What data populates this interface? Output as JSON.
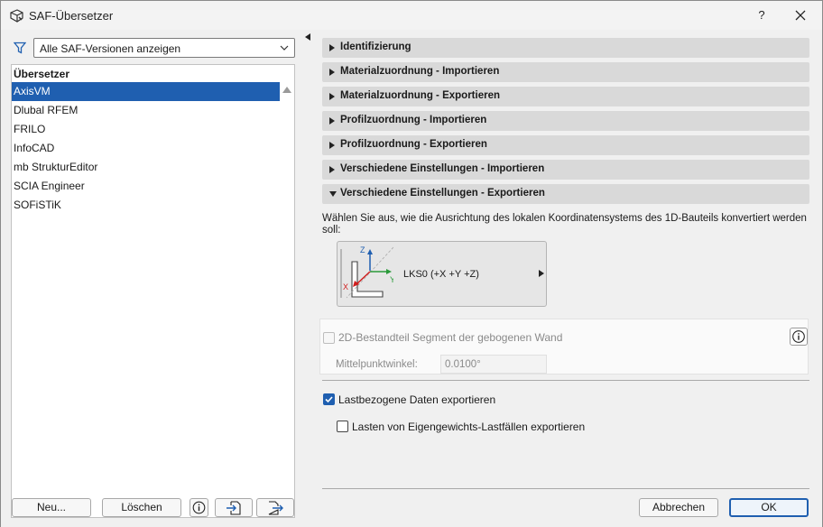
{
  "window": {
    "title": "SAF-Übersetzer",
    "help_label": "?"
  },
  "left": {
    "filter": {
      "icon": "filter-icon",
      "selected_value": "Alle SAF-Versionen anzeigen"
    },
    "list": {
      "header": "Übersetzer",
      "items": [
        {
          "label": "AxisVM",
          "selected": true
        },
        {
          "label": "Dlubal RFEM"
        },
        {
          "label": "FRILO"
        },
        {
          "label": "InfoCAD"
        },
        {
          "label": "mb StrukturEditor"
        },
        {
          "label": "SCIA Engineer"
        },
        {
          "label": "SOFiSTiK"
        }
      ]
    },
    "buttons": {
      "new_label": "Neu...",
      "delete_label": "Löschen"
    }
  },
  "right": {
    "sections": [
      {
        "label": "Identifizierung",
        "expanded": false
      },
      {
        "label": "Materialzuordnung - Importieren",
        "expanded": false
      },
      {
        "label": "Materialzuordnung - Exportieren",
        "expanded": false
      },
      {
        "label": "Profilzuordnung - Importieren",
        "expanded": false
      },
      {
        "label": "Profilzuordnung - Exportieren",
        "expanded": false
      },
      {
        "label": "Verschiedene Einstellungen - Importieren",
        "expanded": false
      },
      {
        "label": "Verschiedene Einstellungen - Exportieren",
        "expanded": true
      }
    ],
    "description": "Wählen Sie aus, wie die Ausrichtung des lokalen Koordinatensystems des 1D-Bauteils konvertiert werden soll:",
    "lks": {
      "label": "LKS0 (+X +Y +Z)",
      "axis_z": "Z",
      "axis_y": "Y",
      "axis_x": "X"
    },
    "segment": {
      "label": "2D-Bestandteil Segment der gebogenen Wand",
      "checked": false,
      "enabled": false
    },
    "angle": {
      "label": "Mittelpunktwinkel:",
      "value": "0.0100°"
    },
    "load_data": {
      "label": "Lastbezogene Daten exportieren",
      "checked": true
    },
    "self_weight": {
      "label": "Lasten von Eigengewichts-Lastfällen exportieren",
      "checked": false
    }
  },
  "footer": {
    "cancel_label": "Abbrechen",
    "ok_label": "OK"
  },
  "colors": {
    "accent": "#1f5fb0",
    "section_bg": "#d9d9d9",
    "window_bg": "#f0f0f0"
  }
}
